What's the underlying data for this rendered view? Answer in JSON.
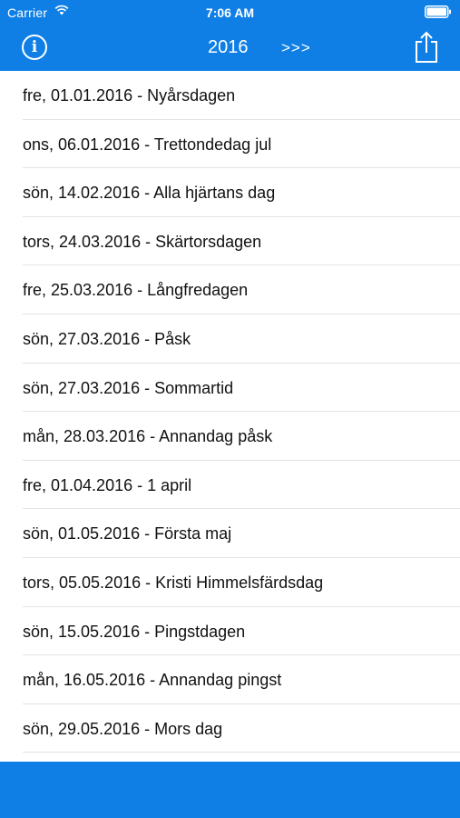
{
  "status_bar": {
    "carrier": "Carrier",
    "time": "7:06 AM"
  },
  "nav": {
    "title": "2016",
    "next_label": ">>>",
    "info_label": "i",
    "icons": [
      "info-icon",
      "share-icon"
    ]
  },
  "colors": {
    "accent": "#0f7fe6",
    "separator": "#e3e3e6",
    "text": "#111111"
  },
  "items": [
    {
      "label": "fre, 01.01.2016 - Nyårsdagen"
    },
    {
      "label": "ons, 06.01.2016 - Trettondedag jul"
    },
    {
      "label": "sön, 14.02.2016 - Alla hjärtans dag"
    },
    {
      "label": "tors, 24.03.2016 - Skärtorsdagen"
    },
    {
      "label": "fre, 25.03.2016 - Långfredagen"
    },
    {
      "label": "sön, 27.03.2016 - Påsk"
    },
    {
      "label": "sön, 27.03.2016 - Sommartid"
    },
    {
      "label": "mån, 28.03.2016 - Annandag påsk"
    },
    {
      "label": "fre, 01.04.2016 - 1 april"
    },
    {
      "label": "sön, 01.05.2016 - Första maj"
    },
    {
      "label": "tors, 05.05.2016 - Kristi Himmelsfärdsdag"
    },
    {
      "label": "sön, 15.05.2016 - Pingstdagen"
    },
    {
      "label": "mån, 16.05.2016 - Annandag pingst"
    },
    {
      "label": "sön, 29.05.2016 - Mors dag"
    }
  ]
}
